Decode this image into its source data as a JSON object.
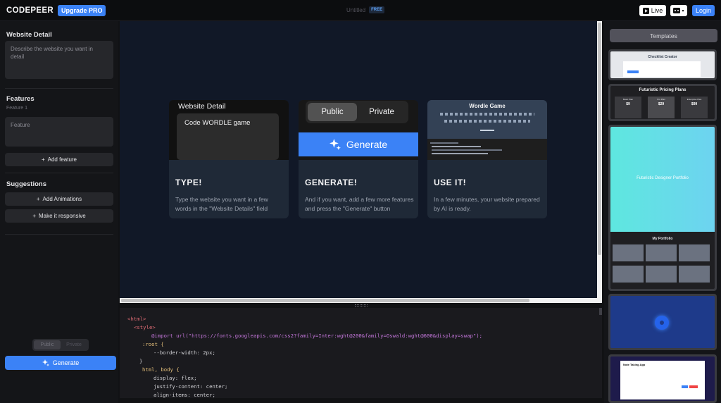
{
  "topbar": {
    "logo": "CODEPEER",
    "upgrade_label": "Upgrade PRO",
    "project_title": "Untitled",
    "plan_badge": "FREE",
    "live_label": "Live",
    "share_icon": "share-icon",
    "login_label": "Login"
  },
  "sidebar": {
    "website_detail_heading": "Website Detail",
    "website_detail_placeholder": "Describe the website you want in detail",
    "features_heading": "Features",
    "feature_sub": "Feature 1",
    "feature_placeholder": "Feature",
    "add_feature_label": "Add feature",
    "suggestions_heading": "Suggestions",
    "suggestions": [
      "Add Animations",
      "Make it responsive"
    ],
    "visibility_options": [
      "Public",
      "Private"
    ],
    "visibility_selected": "Public",
    "generate_label": "Generate"
  },
  "preview": {
    "cards": [
      {
        "heading": "TYPE!",
        "text": "Type the website you want in a few words in the \"Website Details\" field",
        "panel_title": "Website Detail",
        "panel_input": "Code WORDLE game"
      },
      {
        "heading": "GENERATE!",
        "text": "And if you want, add a few more features and press the \"Generate\" button",
        "toggle": [
          "Public",
          "Private"
        ],
        "button_label": "Generate"
      },
      {
        "heading": "USE IT!",
        "text": "In a few minutes, your website prepared by AI is ready.",
        "panel_title": "Wordle Game"
      }
    ]
  },
  "code": {
    "lines": [
      {
        "indent": 0,
        "text": "<html>"
      },
      {
        "indent": 1,
        "text": "<style>"
      },
      {
        "indent": 3,
        "text": "@import url(\"https://fonts.googleapis.com/css2?family=Inter:wght@200&family=Oswald:wght@600&display=swap\");"
      },
      {
        "indent": 2,
        "text": ":root {"
      },
      {
        "indent": 3,
        "text": "--border-width: 2px;"
      },
      {
        "indent": 2,
        "text": "}"
      },
      {
        "indent": 2,
        "text": "html, body {"
      },
      {
        "indent": 3,
        "text": "display: flex;"
      },
      {
        "indent": 3,
        "text": "justify-content: center;"
      },
      {
        "indent": 3,
        "text": "align-items: center;"
      }
    ]
  },
  "templates": {
    "button_label": "Templates",
    "items": [
      {
        "title": "Checklist Creator"
      },
      {
        "title": "Futuristic Pricing Plans",
        "plans": [
          {
            "name": "Basic Plan",
            "price": "$9"
          },
          {
            "name": "Pro Plan",
            "price": "$29"
          },
          {
            "name": "Enterprise Plan",
            "price": "$99"
          }
        ]
      },
      {
        "title": "Futuristic Designer Portfolio",
        "section": "My Portfolio"
      },
      {
        "title": ""
      },
      {
        "title": "Note Taking App"
      }
    ]
  }
}
